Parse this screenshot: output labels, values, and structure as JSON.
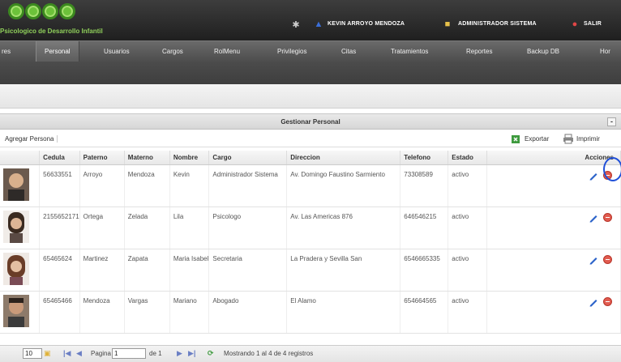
{
  "header": {
    "brand": "Psicologico de Desarrollo Infantil",
    "user_name": "KEVIN ARROYO MENDOZA",
    "role": "ADMINISTRADOR SISTEMA",
    "logout": "SALIR"
  },
  "nav": {
    "items": [
      "res",
      "Personal",
      "Usuarios",
      "Cargos",
      "RolMenu",
      "Privilegios",
      "Citas",
      "Tratamientos",
      "Reportes",
      "Backup DB",
      "Hor"
    ],
    "active": "Personal"
  },
  "panel": {
    "title": "Gestionar Personal",
    "collapse": "-"
  },
  "toolbar": {
    "add": "Agregar Persona",
    "export": "Exportar",
    "print": "Imprimir"
  },
  "table": {
    "headers": [
      "",
      "Cedula",
      "Paterno",
      "Materno",
      "Nombre",
      "Cargo",
      "Direccion",
      "Telefono",
      "Estado",
      "Acciones"
    ],
    "rows": [
      [
        "",
        "56633551",
        "Arroyo",
        "Mendoza",
        "Kevin",
        "Administrador Sistema",
        "Av. Domingo Faustino Sarmiento",
        "73308589",
        "activo"
      ],
      [
        "",
        "2155652171",
        "Ortega",
        "Zelada",
        "Lila",
        "Psicologo",
        "Av. Las Americas 876",
        "646546215",
        "activo"
      ],
      [
        "",
        "65465624",
        "Martinez",
        "Zapata",
        "Maria Isabel",
        "Secretaria",
        "La Pradera y Sevilla San",
        "6546665335",
        "activo"
      ],
      [
        "",
        "65465466",
        "Mendoza",
        "Vargas",
        "Mariano",
        "Abogado",
        "El Alamo",
        "654664565",
        "activo"
      ]
    ]
  },
  "pager": {
    "page_size": "10",
    "page_label": "Pagina",
    "page_value": "1",
    "of_label": "de 1",
    "summary": "Mostrando 1 al 4 de 4 registros"
  },
  "colors": {
    "brand_green": "#6cc23a",
    "header_bg": "#2c2c2c",
    "nav_bg": "#5a5a5a",
    "delete_red": "#e15b4f",
    "highlight": "#1f4fd8"
  }
}
